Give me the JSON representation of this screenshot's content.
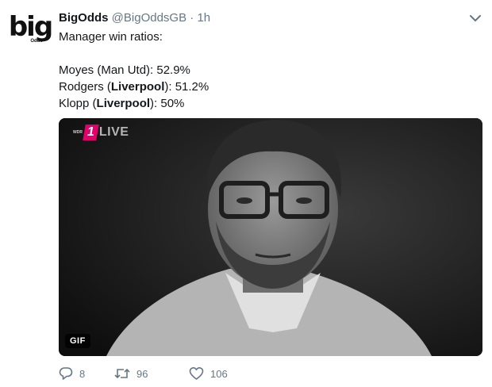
{
  "profile": {
    "logo_text": "big",
    "logo_sub": "Odds",
    "display_name": "BigOdds",
    "handle": "@BigOddsGB",
    "separator": "·",
    "time": "1h"
  },
  "tweet": {
    "intro": "Manager win ratios:",
    "lines": [
      {
        "pre": "Moyes (Man Utd): 52.9%",
        "bold": "",
        "post": ""
      },
      {
        "pre": "Rodgers (",
        "bold": "Liverpool",
        "post": "): 51.2%"
      },
      {
        "pre": "Klopp (",
        "bold": "Liverpool",
        "post": "): 50%"
      }
    ]
  },
  "media": {
    "badge": "GIF",
    "channel_logo_small": "WDR",
    "channel_logo_number": "1",
    "channel_logo_text": "LIVE"
  },
  "actions": {
    "replies": "8",
    "retweets": "96",
    "likes": "106"
  },
  "icons": {
    "menu": "chevron-down-icon",
    "reply": "reply-icon",
    "retweet": "retweet-icon",
    "like": "heart-icon"
  },
  "colors": {
    "text": "#14171a",
    "secondary": "#657786",
    "channel_accent": "#e2006a"
  }
}
